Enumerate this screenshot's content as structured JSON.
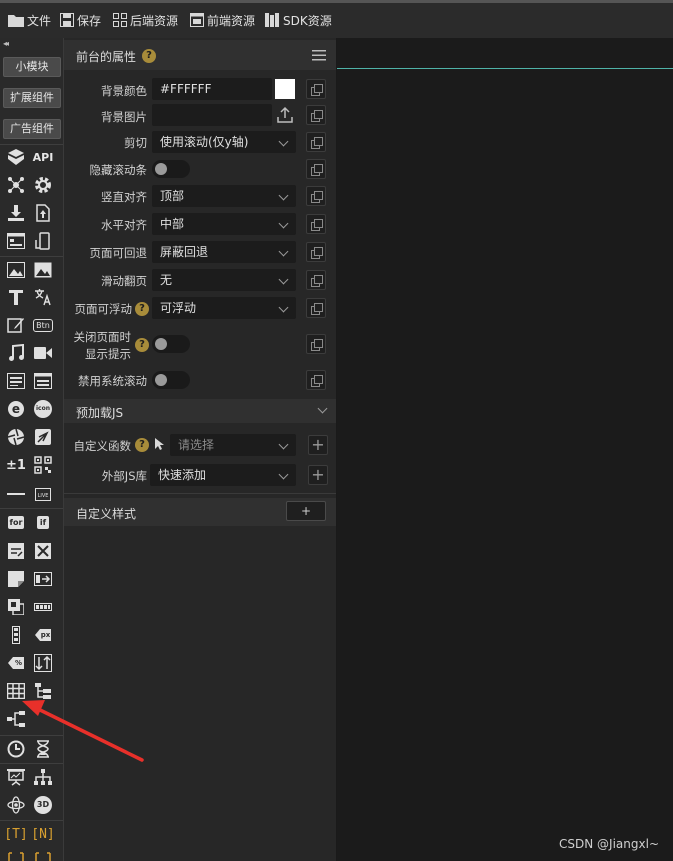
{
  "toolbar": {
    "items": [
      {
        "label": "文件",
        "icon": "folder-icon"
      },
      {
        "label": "保存",
        "icon": "save-icon"
      },
      {
        "label": "后端资源",
        "icon": "grid-icon"
      },
      {
        "label": "前端资源",
        "icon": "window-icon"
      },
      {
        "label": "SDK资源",
        "icon": "library-icon"
      }
    ]
  },
  "palette": {
    "collapse_label": "◂◂",
    "buttons": [
      "小模块",
      "扩展组件",
      "广告组件"
    ],
    "icon_texts": {
      "api": "API",
      "btn": "Btn",
      "pm": "±1",
      "for": "for",
      "if": "if",
      "px": "px",
      "pct": "%",
      "threed": "3D",
      "t": "[T]",
      "n": "[N]",
      "live": "LIVE",
      "icon": "icon"
    }
  },
  "panel": {
    "title": "前台的属性",
    "help_mark": "?",
    "rows": {
      "bg_color": {
        "label": "背景颜色",
        "value": "#FFFFFF"
      },
      "bg_image": {
        "label": "背景图片",
        "value": ""
      },
      "clip": {
        "label": "剪切",
        "value": "使用滚动(仅y轴)"
      },
      "hide_scroll": {
        "label": "隐藏滚动条"
      },
      "valign": {
        "label": "竖直对齐",
        "value": "顶部"
      },
      "halign": {
        "label": "水平对齐",
        "value": "中部"
      },
      "back": {
        "label": "页面可回退",
        "value": "屏蔽回退"
      },
      "paging": {
        "label": "滑动翻页",
        "value": "无"
      },
      "float": {
        "label": "页面可浮动",
        "value": "可浮动"
      },
      "close_hint": {
        "label_line1": "关闭页面时",
        "label_line2": "显示提示"
      },
      "disable_scroll": {
        "label": "禁用系统滚动"
      }
    },
    "preload": {
      "title": "预加载JS",
      "custom_fn": {
        "label": "自定义函数",
        "placeholder": "请选择"
      },
      "external_js": {
        "label": "外部JS库",
        "value": "快速添加"
      }
    },
    "custom_style": {
      "title": "自定义样式",
      "button": "+"
    }
  },
  "watermark": "CSDN @Jiangxl~",
  "colors": {
    "accent_line": "#4fb3a8",
    "help_badge": "#a88c3a",
    "arrow": "#e8302a",
    "bracket_icon": "#d9a030"
  }
}
